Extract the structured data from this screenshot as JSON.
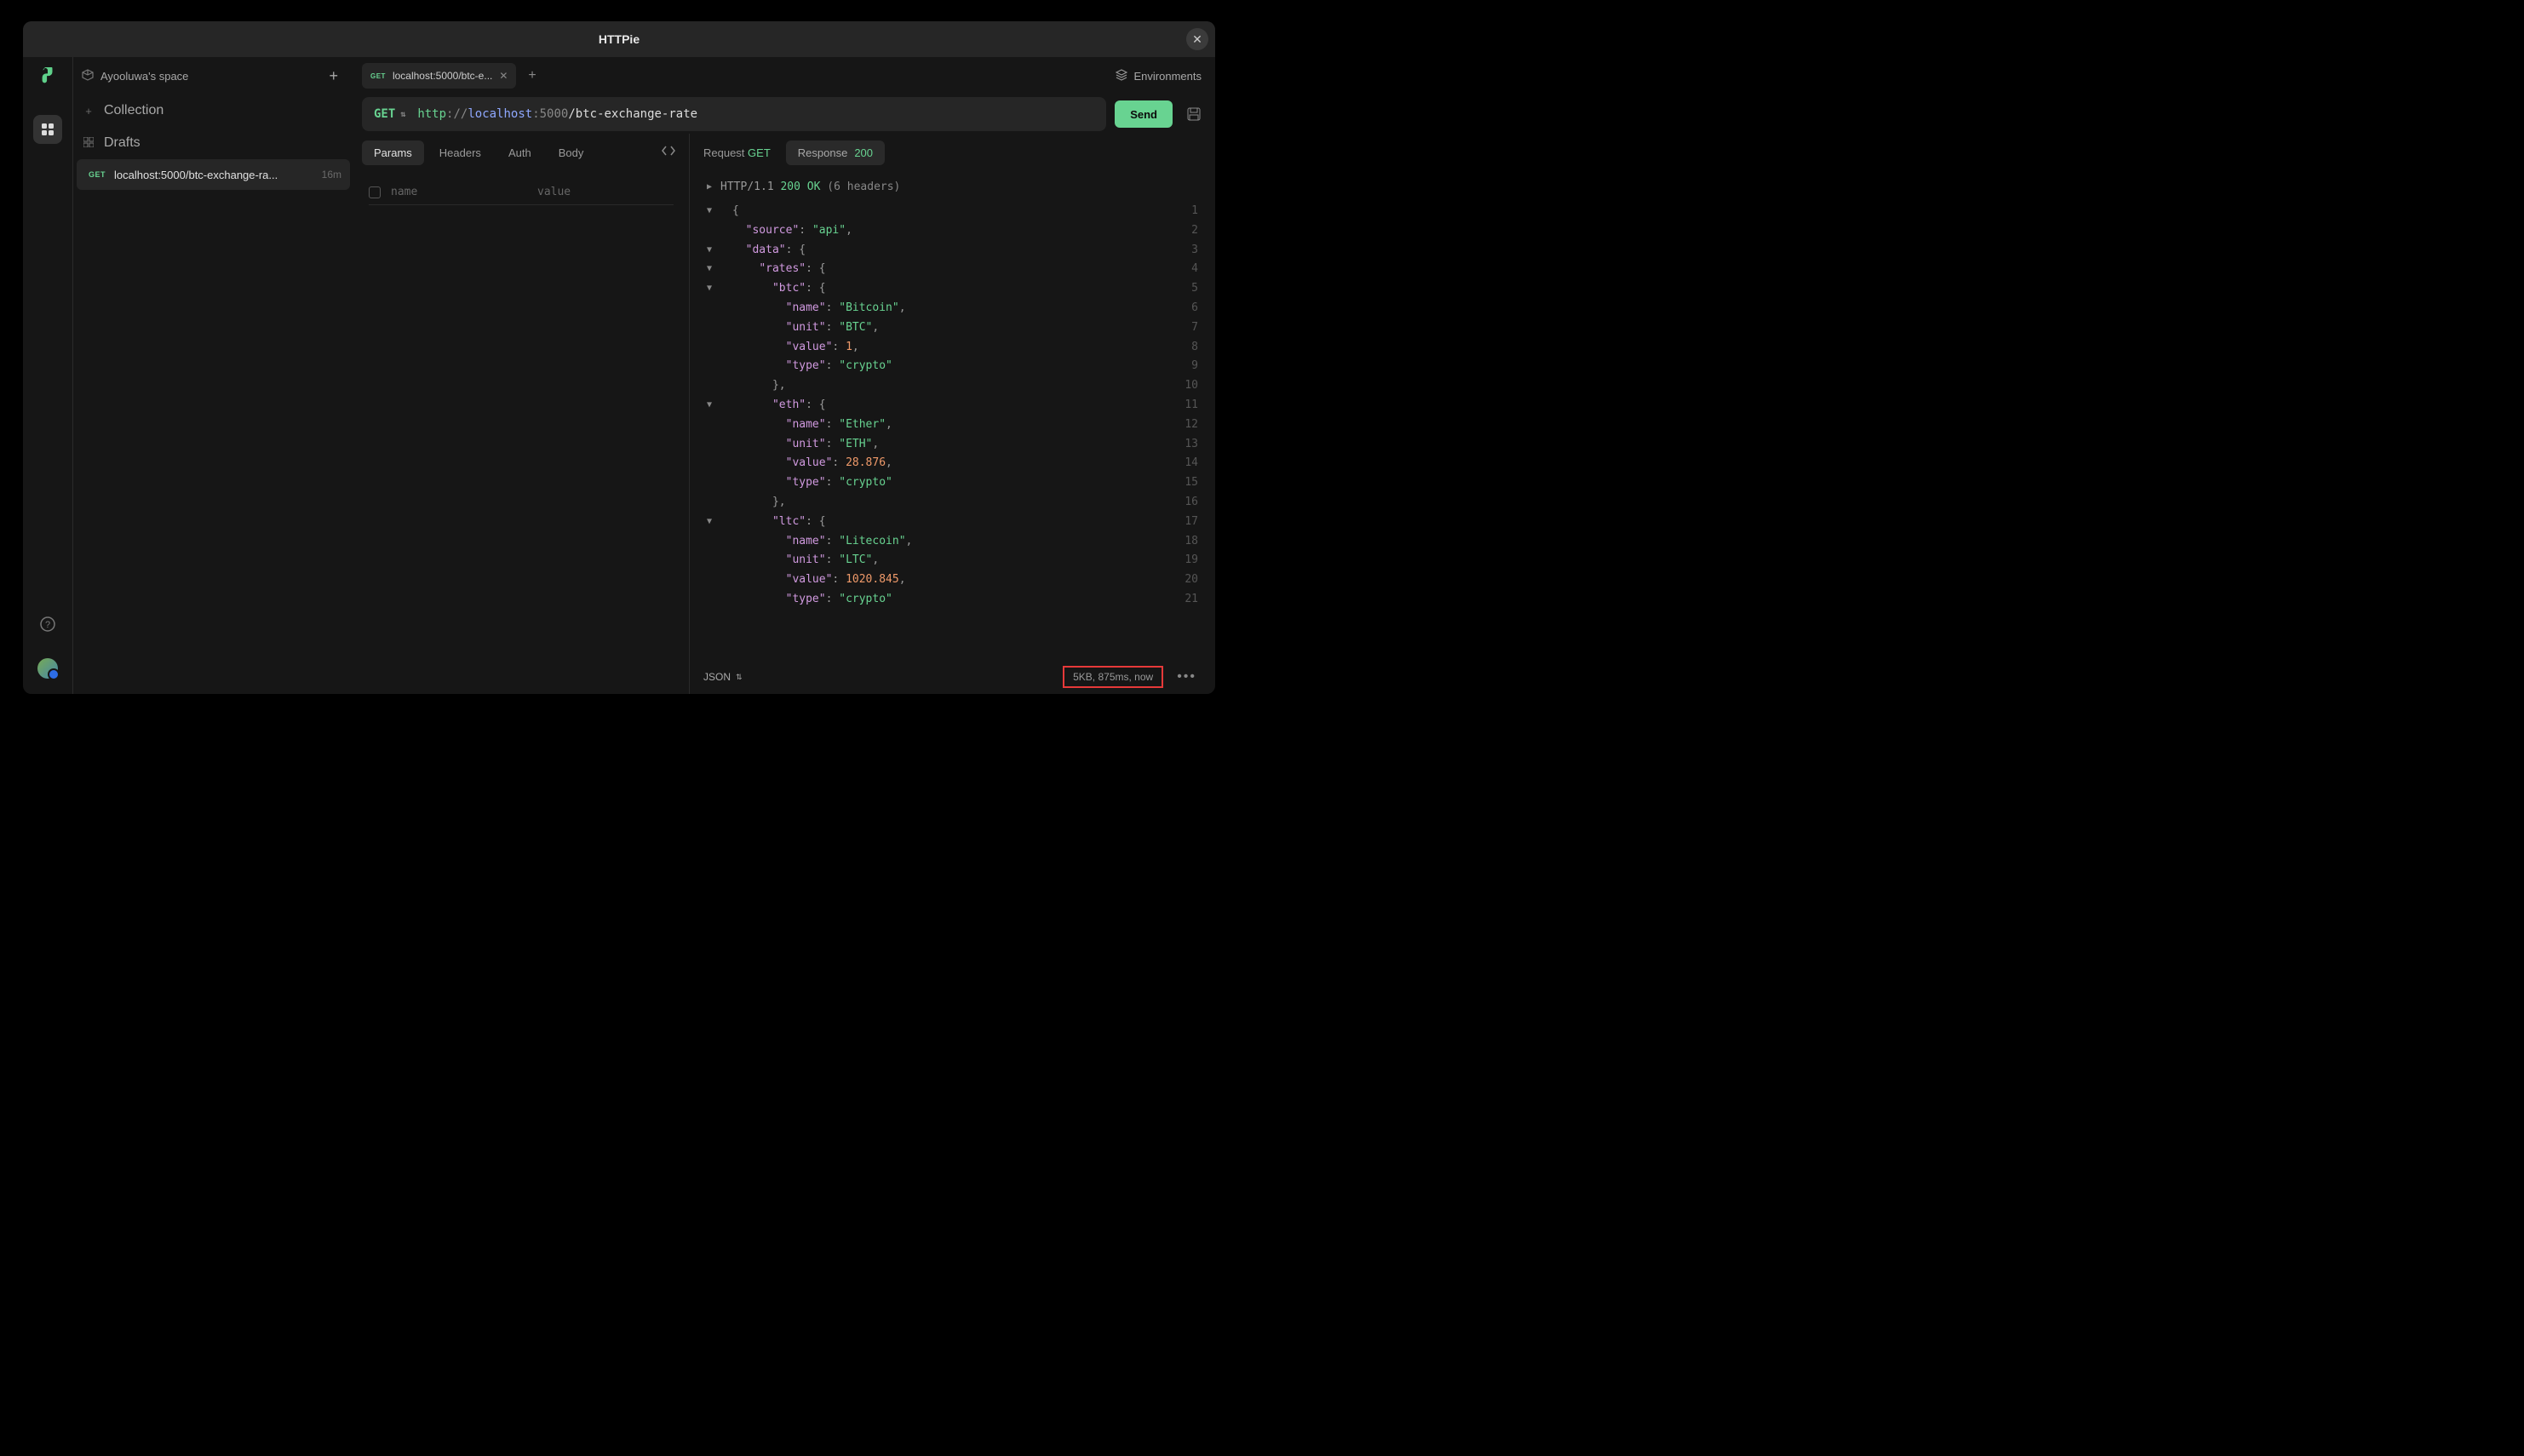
{
  "titlebar": {
    "title": "HTTPie"
  },
  "sidebar": {
    "space_name": "Ayooluwa's space",
    "collection_label": "Collection",
    "drafts_label": "Drafts",
    "draft": {
      "method": "GET",
      "text": "localhost:5000/btc-exchange-ra...",
      "time": "16m"
    }
  },
  "tabs": {
    "tab_method": "GET",
    "tab_text": "localhost:5000/btc-e...",
    "environments_label": "Environments"
  },
  "url": {
    "method": "GET",
    "scheme": "http",
    "sep": "://",
    "host": "localhost",
    "port": ":5000",
    "path": "/btc-exchange-rate",
    "send_label": "Send"
  },
  "request_tabs": {
    "params": "Params",
    "headers": "Headers",
    "auth": "Auth",
    "body": "Body"
  },
  "params": {
    "name_ph": "name",
    "value_ph": "value"
  },
  "response_meta": {
    "request_label": "Request",
    "request_method": "GET",
    "response_label": "Response",
    "response_code": "200",
    "protocol": "HTTP/1.1",
    "status": "200 OK",
    "headers_count": "(6 headers)",
    "format_label": "JSON",
    "stats": "5KB, 875ms, now"
  },
  "response_body": [
    {
      "tri": "▼",
      "indent": 0,
      "t": "brace",
      "txt": "{",
      "ln": 1
    },
    {
      "tri": "",
      "indent": 1,
      "t": "kv",
      "k": "\"source\"",
      "v": "\"api\"",
      "vt": "s",
      "comma": ",",
      "ln": 2
    },
    {
      "tri": "▼",
      "indent": 1,
      "t": "kobj",
      "k": "\"data\"",
      "txt": "{",
      "ln": 3
    },
    {
      "tri": "▼",
      "indent": 2,
      "t": "kobj",
      "k": "\"rates\"",
      "txt": "{",
      "ln": 4
    },
    {
      "tri": "▼",
      "indent": 3,
      "t": "kobj",
      "k": "\"btc\"",
      "txt": "{",
      "ln": 5
    },
    {
      "tri": "",
      "indent": 4,
      "t": "kv",
      "k": "\"name\"",
      "v": "\"Bitcoin\"",
      "vt": "s",
      "comma": ",",
      "ln": 6
    },
    {
      "tri": "",
      "indent": 4,
      "t": "kv",
      "k": "\"unit\"",
      "v": "\"BTC\"",
      "vt": "s",
      "comma": ",",
      "ln": 7
    },
    {
      "tri": "",
      "indent": 4,
      "t": "kv",
      "k": "\"value\"",
      "v": "1",
      "vt": "n",
      "comma": ",",
      "ln": 8
    },
    {
      "tri": "",
      "indent": 4,
      "t": "kv",
      "k": "\"type\"",
      "v": "\"crypto\"",
      "vt": "s",
      "comma": "",
      "ln": 9
    },
    {
      "tri": "",
      "indent": 3,
      "t": "brace",
      "txt": "},",
      "ln": 10
    },
    {
      "tri": "▼",
      "indent": 3,
      "t": "kobj",
      "k": "\"eth\"",
      "txt": "{",
      "ln": 11
    },
    {
      "tri": "",
      "indent": 4,
      "t": "kv",
      "k": "\"name\"",
      "v": "\"Ether\"",
      "vt": "s",
      "comma": ",",
      "ln": 12
    },
    {
      "tri": "",
      "indent": 4,
      "t": "kv",
      "k": "\"unit\"",
      "v": "\"ETH\"",
      "vt": "s",
      "comma": ",",
      "ln": 13
    },
    {
      "tri": "",
      "indent": 4,
      "t": "kv",
      "k": "\"value\"",
      "v": "28.876",
      "vt": "n",
      "comma": ",",
      "ln": 14
    },
    {
      "tri": "",
      "indent": 4,
      "t": "kv",
      "k": "\"type\"",
      "v": "\"crypto\"",
      "vt": "s",
      "comma": "",
      "ln": 15
    },
    {
      "tri": "",
      "indent": 3,
      "t": "brace",
      "txt": "},",
      "ln": 16
    },
    {
      "tri": "▼",
      "indent": 3,
      "t": "kobj",
      "k": "\"ltc\"",
      "txt": "{",
      "ln": 17
    },
    {
      "tri": "",
      "indent": 4,
      "t": "kv",
      "k": "\"name\"",
      "v": "\"Litecoin\"",
      "vt": "s",
      "comma": ",",
      "ln": 18
    },
    {
      "tri": "",
      "indent": 4,
      "t": "kv",
      "k": "\"unit\"",
      "v": "\"LTC\"",
      "vt": "s",
      "comma": ",",
      "ln": 19
    },
    {
      "tri": "",
      "indent": 4,
      "t": "kv",
      "k": "\"value\"",
      "v": "1020.845",
      "vt": "n",
      "comma": ",",
      "ln": 20
    },
    {
      "tri": "",
      "indent": 4,
      "t": "kv",
      "k": "\"type\"",
      "v": "\"crypto\"",
      "vt": "s",
      "comma": "",
      "ln": 21
    }
  ]
}
